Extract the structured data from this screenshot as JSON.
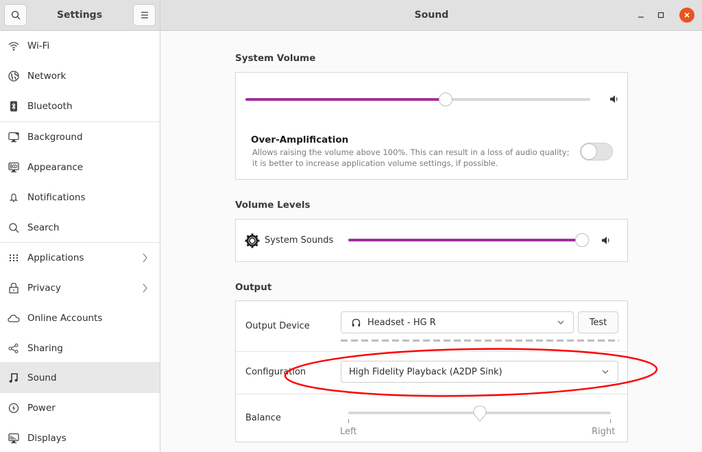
{
  "header": {
    "app_title": "Settings",
    "page_title": "Sound",
    "search_icon": "search-icon",
    "menu_icon": "hamburger-menu-icon",
    "window_controls": [
      "minimize",
      "maximize",
      "close"
    ]
  },
  "sidebar": {
    "items": [
      {
        "label": "Wi-Fi",
        "icon": "wifi-icon",
        "has_chevron": false,
        "active": false
      },
      {
        "label": "Network",
        "icon": "network-globe-icon",
        "has_chevron": false,
        "active": false
      },
      {
        "label": "Bluetooth",
        "icon": "bluetooth-icon",
        "has_chevron": false,
        "active": false
      },
      {
        "label": "Background",
        "icon": "background-monitor-icon",
        "has_chevron": false,
        "active": false
      },
      {
        "label": "Appearance",
        "icon": "appearance-icon",
        "has_chevron": false,
        "active": false
      },
      {
        "label": "Notifications",
        "icon": "bell-icon",
        "has_chevron": false,
        "active": false
      },
      {
        "label": "Search",
        "icon": "search-icon",
        "has_chevron": false,
        "active": false
      },
      {
        "label": "Applications",
        "icon": "grid-icon",
        "has_chevron": true,
        "active": false
      },
      {
        "label": "Privacy",
        "icon": "lock-icon",
        "has_chevron": true,
        "active": false
      },
      {
        "label": "Online Accounts",
        "icon": "cloud-icon",
        "has_chevron": false,
        "active": false
      },
      {
        "label": "Sharing",
        "icon": "share-icon",
        "has_chevron": false,
        "active": false
      },
      {
        "label": "Sound",
        "icon": "music-note-icon",
        "has_chevron": false,
        "active": true
      },
      {
        "label": "Power",
        "icon": "power-icon",
        "has_chevron": false,
        "active": false
      },
      {
        "label": "Displays",
        "icon": "display-icon",
        "has_chevron": false,
        "active": false
      }
    ]
  },
  "system_volume": {
    "title": "System Volume",
    "level": 0.58,
    "over_amplification": {
      "title": "Over-Amplification",
      "description": "Allows raising the volume above 100%. This can result in a loss of audio quality; it is better to increase application volume settings, if possible.",
      "enabled": false
    }
  },
  "volume_levels": {
    "title": "Volume Levels",
    "items": [
      {
        "label": "System Sounds",
        "level": 1.0
      }
    ]
  },
  "output": {
    "title": "Output",
    "device_label": "Output Device",
    "device_value": "Headset - HG R",
    "test_label": "Test",
    "configuration_label": "Configuration",
    "configuration_value": "High Fidelity Playback (A2DP Sink)",
    "balance_label": "Balance",
    "balance_value": 0.5,
    "balance_left": "Left",
    "balance_right": "Right"
  },
  "colors": {
    "accent": "#a1309a",
    "close_button": "#e95420",
    "annotation": "#ff0000"
  },
  "annotation": {
    "shape": "ellipse",
    "target": "configuration-row"
  }
}
